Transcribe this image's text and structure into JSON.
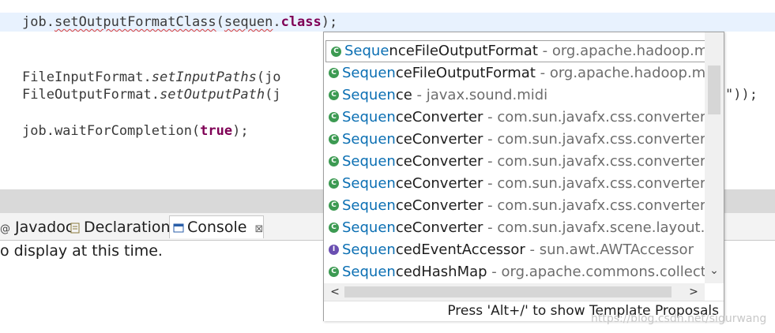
{
  "editor": {
    "line1": {
      "a": "job.",
      "b": "setOutputFormatClass",
      "c": "(",
      "d": "sequen",
      "e": ".",
      "f": "class",
      "g": ");"
    },
    "line2": {
      "a": "FileInputFormat.",
      "b": "setInputPaths",
      "c": "(jo"
    },
    "line3": {
      "a": "FileOutputFormat.",
      "b": "setOutputPath",
      "c": "(j",
      "d": "\"));"
    },
    "line4": {
      "a": "job.waitForCompletion(",
      "b": "true",
      "c": ");"
    }
  },
  "tabs": [
    {
      "label": "Javadoc",
      "prefix": "@"
    },
    {
      "label": "Declaration"
    },
    {
      "label": "Console",
      "close": "⊠"
    }
  ],
  "console": {
    "message": "o display at this time."
  },
  "popup": {
    "items": [
      {
        "match": "Seque",
        "rest": "nceFileOutputFormat",
        "pkg": " - org.apache.hadoop.mapred",
        "icon": "C",
        "selected": true
      },
      {
        "match": "Sequen",
        "rest": "ceFileOutputFormat",
        "pkg": " - org.apache.hadoop.map",
        "icon": "C"
      },
      {
        "match": "Sequen",
        "rest": "ce",
        "pkg": " - javax.sound.midi",
        "icon": "C"
      },
      {
        "match": "Sequen",
        "rest": "ceConverter",
        "pkg": " - com.sun.javafx.css.converters.Ins",
        "icon": "C"
      },
      {
        "match": "Sequen",
        "rest": "ceConverter",
        "pkg": " - com.sun.javafx.css.converters.Pa",
        "icon": "C"
      },
      {
        "match": "Sequen",
        "rest": "ceConverter",
        "pkg": " - com.sun.javafx.css.converters.Siz",
        "icon": "C"
      },
      {
        "match": "Sequen",
        "rest": "ceConverter",
        "pkg": " - com.sun.javafx.css.converters.Str",
        "icon": "C"
      },
      {
        "match": "Sequen",
        "rest": "ceConverter",
        "pkg": " - com.sun.javafx.css.converters.UR",
        "icon": "C"
      },
      {
        "match": "Sequen",
        "rest": "ceConverter",
        "pkg": " - com.sun.javafx.scene.layout.regi",
        "icon": "C"
      },
      {
        "match": "Sequen",
        "rest": "cedEventAccessor",
        "pkg": " - sun.awt.AWTAccessor",
        "icon": "I"
      },
      {
        "match": "Sequen",
        "rest": "cedHashMap",
        "pkg": " - org.apache.commons.collectio",
        "icon": "C"
      }
    ],
    "status": "Press 'Alt+/' to show Template Proposals"
  },
  "watermark": "https://blog.csdn.net/sigurwang",
  "colors": {
    "keyword": "#7f0055",
    "match": "#0b6fb3",
    "package": "#6d6d6d",
    "line_highlight": "#e8f2fe"
  }
}
